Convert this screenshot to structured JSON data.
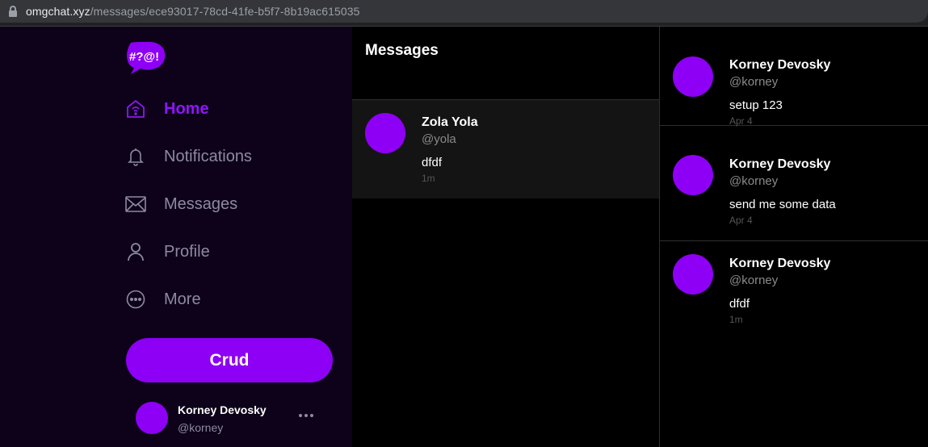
{
  "browser": {
    "url_host": "omgchat.xyz",
    "url_path": "/messages/ece93017-78cd-41fe-b5f7-8b19ac615035"
  },
  "sidebar": {
    "logo_text": "#?@!",
    "items": [
      {
        "label": "Home",
        "icon": "home-icon",
        "active": true
      },
      {
        "label": "Notifications",
        "icon": "bell-icon",
        "active": false
      },
      {
        "label": "Messages",
        "icon": "envelope-icon",
        "active": false
      },
      {
        "label": "Profile",
        "icon": "user-icon",
        "active": false
      },
      {
        "label": "More",
        "icon": "more-circle-icon",
        "active": false
      }
    ],
    "crud_label": "Crud",
    "user": {
      "name": "Korney Devosky",
      "handle": "@korney"
    }
  },
  "middle": {
    "title": "Messages",
    "conversations": [
      {
        "name": "Zola Yola",
        "handle": "@yola",
        "text": "dfdf",
        "time": "1m"
      }
    ]
  },
  "thread": {
    "messages": [
      {
        "name": "Korney Devosky",
        "handle": "@korney",
        "text": "setup 123",
        "time": "Apr 4"
      },
      {
        "name": "Korney Devosky",
        "handle": "@korney",
        "text": "send me some data",
        "time": "Apr 4"
      },
      {
        "name": "Korney Devosky",
        "handle": "@korney",
        "text": "dfdf",
        "time": "1m"
      }
    ]
  },
  "colors": {
    "accent": "#8e00f5",
    "sidebar_bg": "#0d0219",
    "muted": "#8e8aa0"
  }
}
